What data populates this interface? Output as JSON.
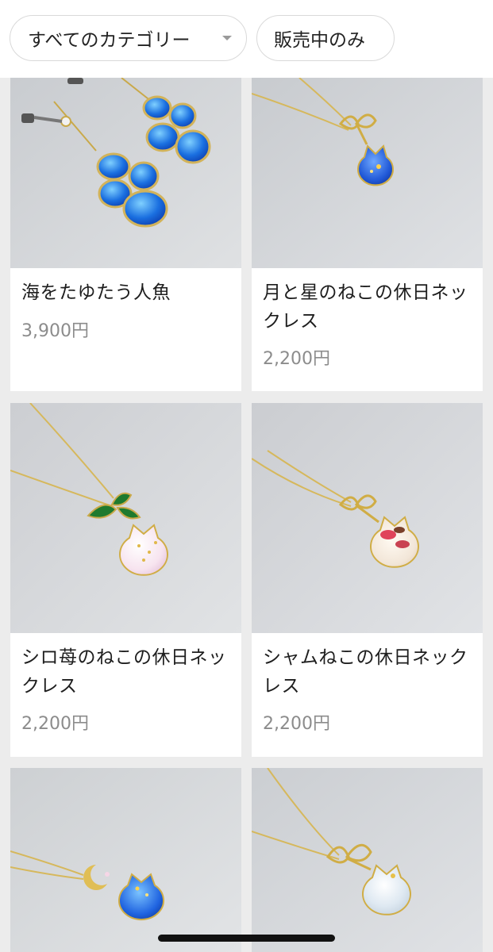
{
  "filters": {
    "category_label": "すべてのカテゴリー",
    "on_sale_label": "販売中のみ"
  },
  "products": [
    {
      "title": "海をたゆたう人魚",
      "price": "3,900円"
    },
    {
      "title": "月と星のねこの休日ネックレス",
      "price": "2,200円"
    },
    {
      "title": "シロ苺のねこの休日ネックレス",
      "price": "2,200円"
    },
    {
      "title": "シャムねこの休日ネックレス",
      "price": "2,200円"
    }
  ],
  "icons": {
    "category_dropdown": "chevron-down-icon"
  },
  "colors": {
    "background": "#ececec",
    "card": "#ffffff",
    "title_text": "#1e1e1e",
    "price_text": "#8c8c8c"
  }
}
